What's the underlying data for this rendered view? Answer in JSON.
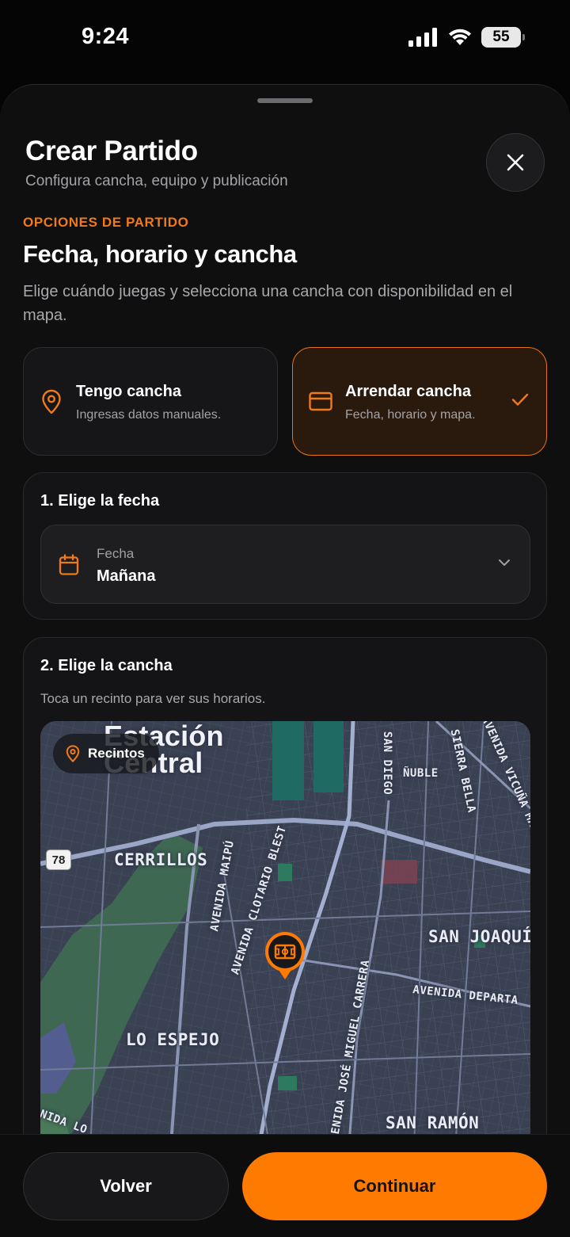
{
  "status_bar": {
    "time": "9:24",
    "battery": "55"
  },
  "header": {
    "title": "Crear Partido",
    "subtitle": "Configura cancha, equipo y publicación"
  },
  "section": {
    "eyebrow": "OPCIONES DE PARTIDO",
    "title": "Fecha, horario y cancha",
    "description": "Elige cuándo juegas y selecciona una cancha con disponibilidad en el mapa."
  },
  "options": {
    "own": {
      "title": "Tengo cancha",
      "subtitle": "Ingresas datos manuales."
    },
    "rent": {
      "title": "Arrendar cancha",
      "subtitle": "Fecha, horario y mapa.",
      "selected": true
    }
  },
  "date_step": {
    "title": "1. Elige la fecha",
    "field_label": "Fecha",
    "field_value": "Mañana"
  },
  "field_step": {
    "title": "2. Elige la cancha",
    "hint": "Toca un recinto para ver sus horarios.",
    "map": {
      "chip_label": "Recintos",
      "route_badge": "78",
      "labels": {
        "station": "Estación Central",
        "cerrillos": "CERRILLOS",
        "lo_espejo": "LO ESPEJO",
        "san_joaquin": "SAN JOAQUÍN",
        "san_ramon": "SAN RAMÓN",
        "nuble": "ÑUBLE",
        "san_diego": "SAN DIEGO",
        "sierra_bella": "SIERRA BELLA",
        "vicuna": "AVENIDA VICUÑA MACKENNA",
        "maipu": "AVENIDA MAIPÚ",
        "clotario": "AVENIDA CLOTARIO BLEST",
        "carrera": "AVENIDA JOSÉ MIGUEL CARRERA",
        "departamental": "AVENIDA DEPARTA",
        "bottom_left": "NIDA LO"
      }
    }
  },
  "actions": {
    "back": "Volver",
    "next": "Continuar"
  },
  "colors": {
    "accent": "#ff7a00",
    "background": "#0f0f10",
    "card": "#141416"
  }
}
